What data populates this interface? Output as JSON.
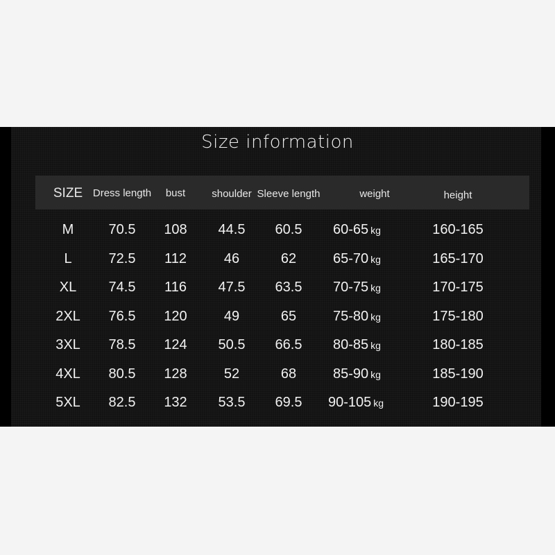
{
  "title": "Size information",
  "columns": [
    "SIZE",
    "Dress length",
    "bust",
    "shoulder",
    "Sleeve length",
    "weight",
    "height"
  ],
  "weight_unit": "kg",
  "rows": [
    {
      "size": "M",
      "dress_length": "70.5",
      "bust": "108",
      "shoulder": "44.5",
      "sleeve_length": "60.5",
      "weight": "60-65",
      "height": "160-165"
    },
    {
      "size": "L",
      "dress_length": "72.5",
      "bust": "112",
      "shoulder": "46",
      "sleeve_length": "62",
      "weight": "65-70",
      "height": "165-170"
    },
    {
      "size": "XL",
      "dress_length": "74.5",
      "bust": "116",
      "shoulder": "47.5",
      "sleeve_length": "63.5",
      "weight": "70-75",
      "height": "170-175"
    },
    {
      "size": "2XL",
      "dress_length": "76.5",
      "bust": "120",
      "shoulder": "49",
      "sleeve_length": "65",
      "weight": "75-80",
      "height": "175-180"
    },
    {
      "size": "3XL",
      "dress_length": "78.5",
      "bust": "124",
      "shoulder": "50.5",
      "sleeve_length": "66.5",
      "weight": "80-85",
      "height": "180-185"
    },
    {
      "size": "4XL",
      "dress_length": "80.5",
      "bust": "128",
      "shoulder": "52",
      "sleeve_length": "68",
      "weight": "85-90",
      "height": "185-190"
    },
    {
      "size": "5XL",
      "dress_length": "82.5",
      "bust": "132",
      "shoulder": "53.5",
      "sleeve_length": "69.5",
      "weight": "90-105",
      "height": "190-195"
    }
  ]
}
